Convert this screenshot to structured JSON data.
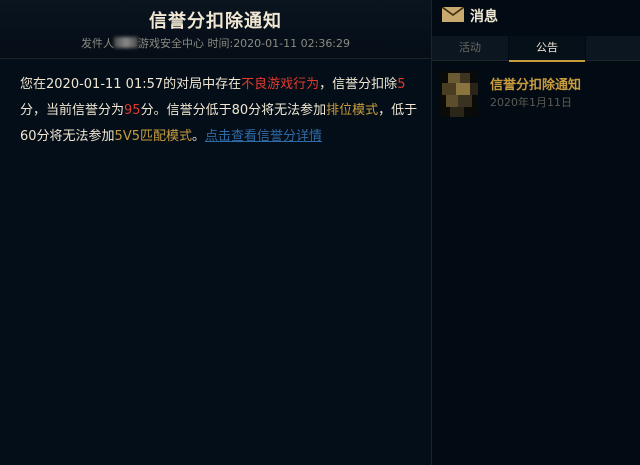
{
  "detail": {
    "title": "信誉分扣除通知",
    "sender_label": "发件人",
    "sender_suffix": "游戏安全中心",
    "time_label": "时间:",
    "time_value": "2020-01-11 02:36:29",
    "body": {
      "seg1": "您在2020-01-11 01:57的对局中存在",
      "seg2_red": "不良游戏行为",
      "seg3": "，信誉分扣除",
      "seg4_red": "5",
      "seg5": "分，当前信誉分为",
      "seg6_red": "95",
      "seg7": "分。信誉分低于80分将无法参加",
      "seg8_gold": "排位模式",
      "seg9": "，低于60分将无法参加",
      "seg10_gold": "5V5匹配模式",
      "seg11": "。",
      "link": "点击查看信誉分详情"
    }
  },
  "panel": {
    "title": "消息",
    "icon": "mail-icon",
    "tabs": [
      "活动",
      "公告"
    ],
    "active_tab": "公告"
  },
  "notices": [
    {
      "title": "信誉分扣除通知",
      "date": "2020年1月11日"
    }
  ],
  "colors": {
    "accent_gold": "#c89b3c",
    "warning_red": "#e03a2f",
    "link_blue": "#2e6aa6",
    "background": "#010a13"
  }
}
